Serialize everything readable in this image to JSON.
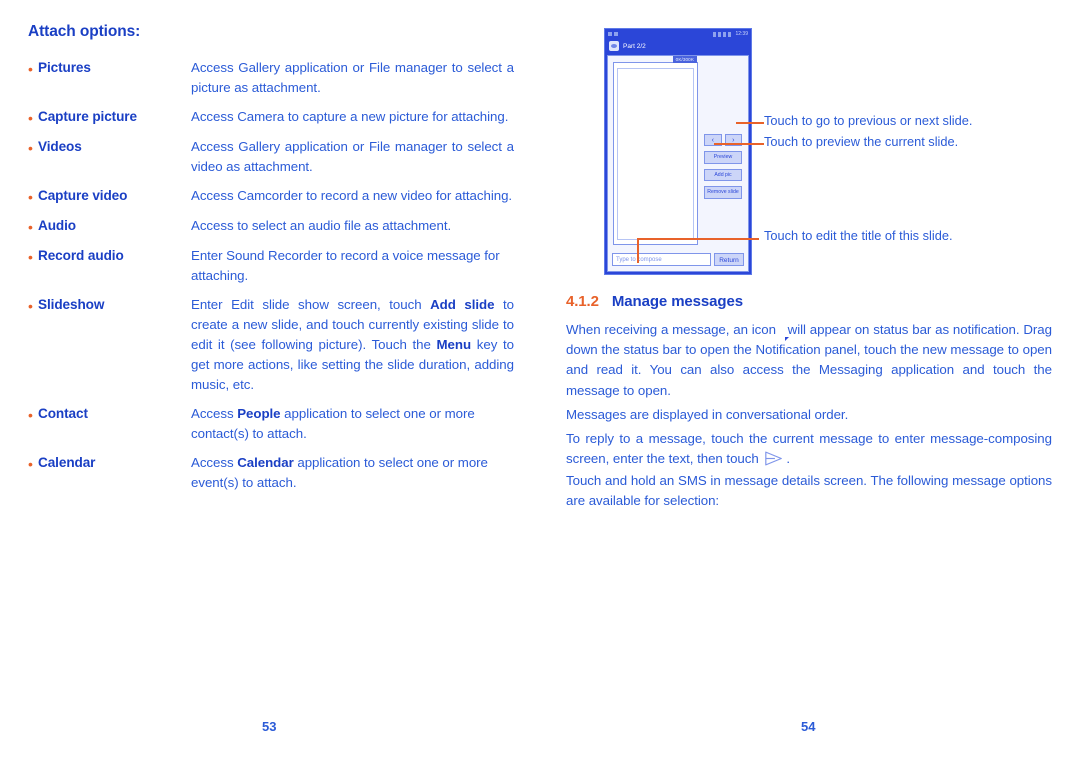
{
  "left_page": {
    "heading": "Attach options:",
    "page_number": "53",
    "options": [
      {
        "term": "Pictures",
        "desc": "Access Gallery application or File manager to select a picture as attachment."
      },
      {
        "term": "Capture picture",
        "desc": "Access Camera to capture a new picture for attaching."
      },
      {
        "term": "Videos",
        "desc": "Access Gallery application or File manager to select a video as attachment."
      },
      {
        "term": "Capture video",
        "desc": "Access Camcorder to record a new video for attaching."
      },
      {
        "term": "Audio",
        "desc": "Access to select an audio file as attachment."
      },
      {
        "term": "Record audio",
        "desc": "Enter Sound Recorder to record a voice message for attaching."
      },
      {
        "term": "Slideshow",
        "desc_part1": "Enter Edit slide show screen, touch ",
        "desc_bold1": "Add slide",
        "desc_part2": " to create a new slide, and touch currently existing slide to edit it (see following picture). Touch the ",
        "desc_bold2": "Menu",
        "desc_part3": " key to get more actions, like setting the slide duration, adding music, etc."
      },
      {
        "term": "Contact",
        "desc_part1": "Access ",
        "desc_bold1": "People",
        "desc_part2": " application to select one or more contact(s) to attach."
      },
      {
        "term": "Calendar",
        "desc_part1": "Access ",
        "desc_bold1": "Calendar",
        "desc_part2": " application to select one or more event(s) to attach."
      }
    ]
  },
  "right_page": {
    "page_number": "54",
    "figure": {
      "status_bar": {
        "clock": "12:39"
      },
      "app_bar": {
        "title": "Part 2/2",
        "icon": "message-app-icon"
      },
      "size_badge": "0K/300K",
      "buttons": {
        "prev": "‹",
        "next": "›",
        "preview": "Preview",
        "add_pic": "Add pic",
        "remove_slide": "Remove slide"
      },
      "compose_placeholder": "Type to compose",
      "return_label": "Return"
    },
    "callouts": [
      "Touch to go to previous or next slide.",
      "Touch to preview the current slide.",
      "Touch to edit the title of this slide."
    ],
    "section": {
      "number": "4.1.2",
      "title": "Manage messages"
    },
    "paragraphs": {
      "p1_a": "When receiving a message, an icon ",
      "p1_b": " will appear on status bar as notification. Drag down the status bar to open the Notification panel, touch the new message to open and read it. You can also access the Messaging application and touch the message to open.",
      "p2": "Messages are displayed in conversational order.",
      "p3_a": "To reply to a message, touch the current message to enter message-composing screen, enter the text, then touch ",
      "p3_b": ".",
      "p4": "Touch and hold an SMS in message details screen. The following message options are available for selection:"
    }
  },
  "colors": {
    "body_blue": "#2b5bd7",
    "heading_blue": "#1a3fc4",
    "accent_orange": "#e8622a",
    "phone_blue": "#2b46d8"
  }
}
